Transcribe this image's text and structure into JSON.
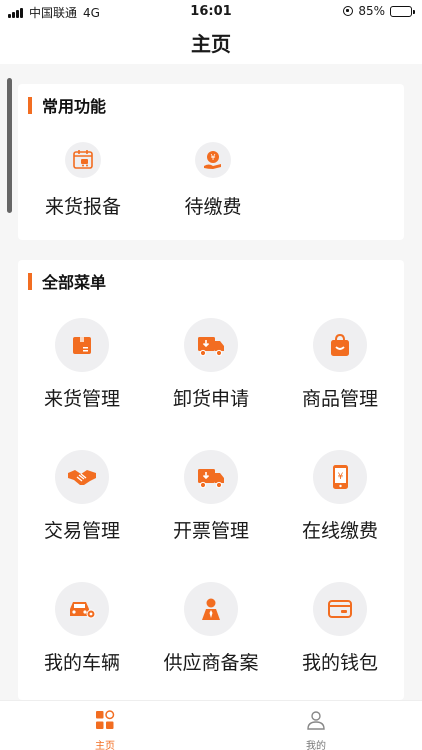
{
  "status_bar": {
    "carrier": "中国联通",
    "network": "4G",
    "time": "16:01",
    "battery": "85%",
    "battery_level": 0.85
  },
  "header": {
    "title": "主页"
  },
  "common": {
    "title": "常用功能",
    "items": [
      {
        "label": "来货报备",
        "icon": "truck-calendar-icon"
      },
      {
        "label": "待缴费",
        "icon": "yuan-hand-icon"
      }
    ]
  },
  "all_menu": {
    "title": "全部菜单",
    "items": [
      {
        "label": "来货管理",
        "icon": "package-box-icon"
      },
      {
        "label": "卸货申请",
        "icon": "unload-truck-icon"
      },
      {
        "label": "商品管理",
        "icon": "shopping-bag-icon"
      },
      {
        "label": "交易管理",
        "icon": "handshake-icon"
      },
      {
        "label": "开票管理",
        "icon": "invoice-truck-icon"
      },
      {
        "label": "在线缴费",
        "icon": "mobile-pay-icon"
      },
      {
        "label": "我的车辆",
        "icon": "car-gear-icon"
      },
      {
        "label": "供应商备案",
        "icon": "supplier-person-icon"
      },
      {
        "label": "我的钱包",
        "icon": "wallet-card-icon"
      }
    ]
  },
  "tabbar": {
    "items": [
      {
        "label": "主页",
        "icon": "home-grid-icon",
        "active": true
      },
      {
        "label": "我的",
        "icon": "user-icon",
        "active": false
      }
    ]
  },
  "colors": {
    "accent": "#f26d21",
    "icon_bg": "#efeff1"
  }
}
